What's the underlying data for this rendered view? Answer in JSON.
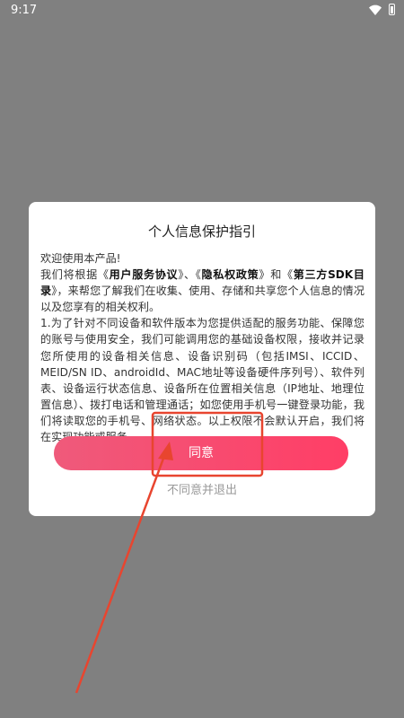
{
  "status_bar": {
    "time": "9:17"
  },
  "dialog": {
    "title": "个人信息保护指引",
    "welcome": "欢迎使用本产品!",
    "p1_prefix": "我们将根据《",
    "link_user_agreement": "用户服务协议",
    "p1_sep1": "》、《",
    "link_privacy_policy": "隐私权政策",
    "p1_sep2": "》和《",
    "link_third_party_sdk": "第三方SDK目录",
    "p1_suffix": "》，来帮您了解我们在收集、使用、存储和共享您个人信息的情况以及您享有的相关权利。",
    "p2": "1.为了针对不同设备和软件版本为您提供适配的服务功能、保障您的账号与使用安全，我们可能调用您的基础设备权限，接收并记录您所使用的设备相关信息、设备识别码（包括IMSI、ICCID、MEID/SN ID、androidId、MAC地址等设备硬件序列号）、软件列表、设备运行状态信息、设备所在位置相关信息（IP地址、地理位置信息）、拨打电话和管理通话；如您使用手机号一键登录功能，我们将读取您的手机号、网络状态。以上权限不会默认开启，我们将在实现功能或服务",
    "agree_label": "同意",
    "disagree_label": "不同意并退出"
  },
  "colors": {
    "backdrop": "#808080",
    "button_gradient_start": "#ef5a7b",
    "button_gradient_end": "#ff3e66",
    "annotation_red": "#e8452f"
  }
}
